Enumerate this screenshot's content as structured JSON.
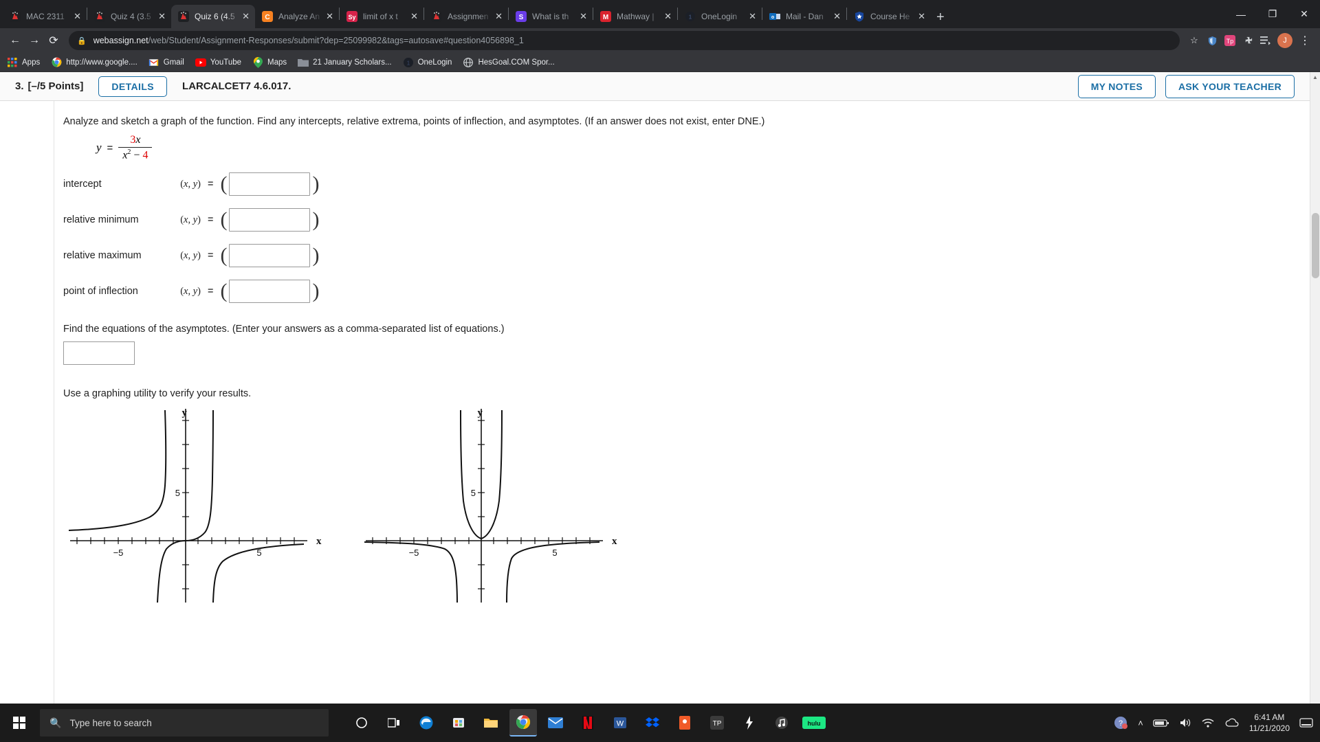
{
  "browser": {
    "tabs": [
      {
        "title": "MAC 2311",
        "icon": "webassign-icon",
        "active": false
      },
      {
        "title": "Quiz 4 (3.5",
        "icon": "webassign-icon",
        "active": false
      },
      {
        "title": "Quiz 6 (4.5",
        "icon": "webassign-icon",
        "active": true
      },
      {
        "title": "Analyze An",
        "icon": "chegg-icon",
        "active": false
      },
      {
        "title": "limit of x t",
        "icon": "symbolab-icon",
        "active": false
      },
      {
        "title": "Assignmen",
        "icon": "webassign-icon",
        "active": false
      },
      {
        "title": "What is th",
        "icon": "slader-icon",
        "active": false
      },
      {
        "title": "Mathway |",
        "icon": "mathway-icon",
        "active": false
      },
      {
        "title": "OneLogin",
        "icon": "onelogin-icon",
        "active": false
      },
      {
        "title": "Mail - Dan",
        "icon": "outlook-icon",
        "active": false
      },
      {
        "title": "Course He",
        "icon": "coursehero-icon",
        "active": false
      }
    ],
    "new_tab_label": "+",
    "close_label": "✕",
    "window_controls": {
      "minimize": "—",
      "maximize": "❐",
      "close": "✕"
    },
    "nav": {
      "back": "←",
      "forward": "→",
      "reload": "⟳"
    },
    "omnibox": {
      "lock_icon": "lock-icon",
      "url_domain": "webassign.net",
      "url_path": "/web/Student/Assignment-Responses/submit?dep=25099982&tags=autosave#question4056898_1",
      "star_icon": "☆"
    },
    "extensions": [
      "shield-icon",
      "tp-icon",
      "puzzle-icon",
      "list-icon"
    ],
    "profile_initial": "J",
    "menu_icon": "⋮",
    "bookmarks": [
      {
        "label": "Apps",
        "icon": "apps-grid-icon"
      },
      {
        "label": "http://www.google....",
        "icon": "chrome-icon"
      },
      {
        "label": "Gmail",
        "icon": "gmail-icon"
      },
      {
        "label": "YouTube",
        "icon": "youtube-icon"
      },
      {
        "label": "Maps",
        "icon": "maps-icon"
      },
      {
        "label": "21 January Scholars...",
        "icon": "folder-icon"
      },
      {
        "label": "OneLogin",
        "icon": "onelogin-icon"
      },
      {
        "label": "HesGoal.COM Spor...",
        "icon": "globe-icon"
      }
    ]
  },
  "question": {
    "number": "3.",
    "points": "[–/5 Points]",
    "details_button": "DETAILS",
    "code": "LARCALCET7 4.6.017.",
    "my_notes_button": "MY NOTES",
    "ask_teacher_button": "ASK YOUR TEACHER",
    "prompt": "Analyze and sketch a graph of the function. Find any intercepts, relative extrema, points of inflection, and asymptotes. (If an answer does not exist, enter DNE.)",
    "equation": {
      "lhs": "y",
      "equals": "=",
      "numerator_coefficient": "3",
      "numerator_variable": "x",
      "denominator_variable": "x",
      "denominator_exponent": "2",
      "denominator_operator": "−",
      "denominator_constant": "4"
    },
    "answers": [
      {
        "label": "intercept",
        "coord": "(x, y)",
        "equals": "=",
        "value": ""
      },
      {
        "label": "relative minimum",
        "coord": "(x, y)",
        "equals": "=",
        "value": ""
      },
      {
        "label": "relative maximum",
        "coord": "(x, y)",
        "equals": "=",
        "value": ""
      },
      {
        "label": "point of inflection",
        "coord": "(x, y)",
        "equals": "=",
        "value": ""
      }
    ],
    "open_paren": "(",
    "close_paren": ")",
    "asymptote_prompt": "Find the equations of the asymptotes. (Enter your answers as a comma-separated list of equations.)",
    "asymptote_value": "",
    "graphing_prompt": "Use a graphing utility to verify your results."
  },
  "chart_data": [
    {
      "type": "line",
      "title": "",
      "xlabel": "x",
      "ylabel": "y",
      "xlim": [
        -9,
        9
      ],
      "ylim": [
        -9,
        9
      ],
      "xticks": [
        -5,
        5
      ],
      "yticks": [
        5
      ],
      "xtick_labels": [
        "−5",
        "5"
      ],
      "ytick_labels": [
        "5"
      ],
      "grid": false,
      "legend": null,
      "description": "Rational function with vertical asymptotes near x = -2 and x = 2; branches approach y = 0",
      "asymptotes": {
        "vertical": [
          -2,
          2
        ],
        "horizontal": [
          0
        ]
      }
    },
    {
      "type": "line",
      "title": "",
      "xlabel": "x",
      "ylabel": "y",
      "xlim": [
        -9,
        9
      ],
      "ylim": [
        -9,
        9
      ],
      "xticks": [
        -5,
        5
      ],
      "yticks": [
        5
      ],
      "xtick_labels": [
        "−5",
        "5"
      ],
      "ytick_labels": [
        "5"
      ],
      "grid": false,
      "legend": null,
      "description": "Rational function with vertical asymptotes near x = -2 and x = 2; middle branch opens upward with minimum at origin region",
      "asymptotes": {
        "vertical": [
          -2,
          2
        ],
        "horizontal": [
          0
        ]
      }
    }
  ],
  "taskbar": {
    "start_icon": "windows-start-icon",
    "search_placeholder": "Type here to search",
    "search_icon": "search-icon",
    "icons": [
      "cortana-icon",
      "task-view-icon",
      "edge-icon",
      "store-icon",
      "file-explorer-icon",
      "chrome-icon",
      "mail-icon",
      "netflix-icon",
      "word-icon",
      "dropbox-icon",
      "reader-icon",
      "tp-icon",
      "bolt-icon",
      "music-icon",
      "hulu-icon"
    ],
    "tray": {
      "help_icon": "help-icon",
      "chevron_icon": "˄",
      "battery_icon": "battery-icon",
      "volume_icon": "\u0001f50a",
      "wifi_icon": "wifi-icon",
      "onedrive_icon": "onedrive-icon",
      "time": "6:41 AM",
      "date": "11/21/2020",
      "notification_icon": "notification-icon"
    }
  }
}
